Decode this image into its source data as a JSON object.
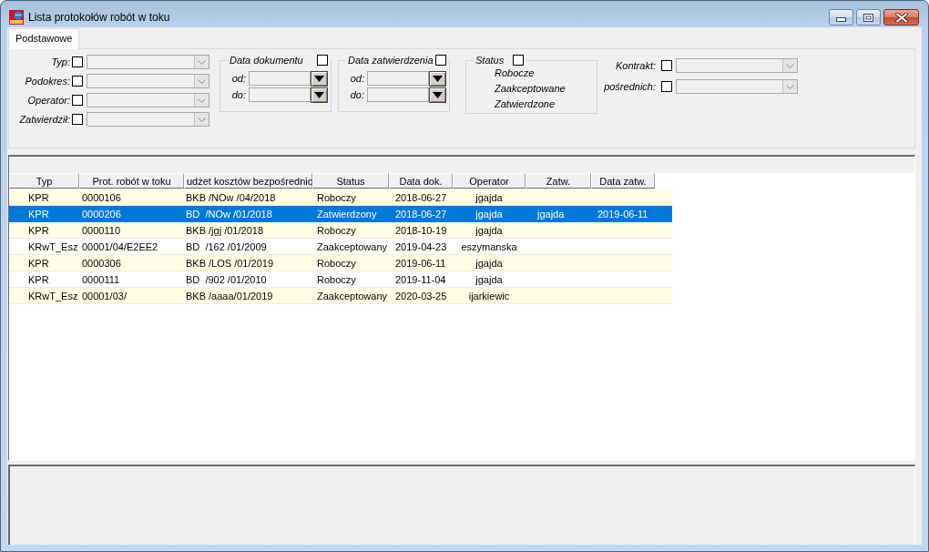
{
  "window": {
    "title": "Lista protokołów robót w toku"
  },
  "tabs": [
    {
      "label": "Podstawowe",
      "selected": true
    }
  ],
  "filters": {
    "left": [
      {
        "label": "Typ:",
        "checked": false,
        "disabled": true
      },
      {
        "label": "Podokres:",
        "checked": false,
        "disabled": true
      },
      {
        "label": "Operator:",
        "checked": false,
        "disabled": true
      },
      {
        "label": "Zatwierdził:",
        "checked": false,
        "disabled": true
      }
    ],
    "date_groups": [
      {
        "title": "Data dokumentu",
        "checked": false,
        "fields": [
          {
            "label": "od:",
            "disabled": true
          },
          {
            "label": "do:",
            "disabled": true
          }
        ]
      },
      {
        "title": "Data zatwierdzenia",
        "checked": false,
        "fields": [
          {
            "label": "od:",
            "disabled": true
          },
          {
            "label": "do:",
            "disabled": true
          }
        ]
      }
    ],
    "status_group": {
      "title": "Status",
      "checked": false,
      "items": [
        "Robocze",
        "Zaakceptowane",
        "Zatwierdzone"
      ]
    },
    "right": [
      {
        "label": "Kontrakt:",
        "checked": false,
        "disabled": true
      },
      {
        "label": "pośrednich:",
        "checked": false,
        "disabled": true
      }
    ]
  },
  "table": {
    "columns": [
      "Typ",
      "Prot. robót w toku",
      "udżet kosztów bezpośrednic",
      "Status",
      "Data dok.",
      "Operator",
      "Zatw.",
      "Data zatw."
    ],
    "rows": [
      {
        "typ": "KPR",
        "protokol": "0000106",
        "budzet_kosztow": "BKB /NOw /04/2018",
        "status": "Roboczy",
        "data_dok": "2018-06-27",
        "operator": "jgajda",
        "selected": false
      },
      {
        "typ": "KPR",
        "protokol": "0000206",
        "budzet_kosztow": "BD  /NOw /01/2018",
        "status": "Zatwierdzony",
        "data_dok": "2018-06-27",
        "operator": "jgajda",
        "zatw": "jgajda",
        "data_zatw": "2019-06-11",
        "selected": true
      },
      {
        "typ": "KPR",
        "protokol": "0000110",
        "budzet_kosztow": "BKB /jgj /01/2018",
        "status": "Roboczy",
        "data_dok": "2018-10-19",
        "operator": "jgajda",
        "selected": false
      },
      {
        "typ": "KRwT_Esz",
        "protokol": "00001/04/E2EE2",
        "budzet_kosztow": "BD  /162 /01/2009",
        "status": "Zaakceptowany",
        "data_dok": "2019-04-23",
        "operator": "eszymanska",
        "selected": false
      },
      {
        "typ": "KPR",
        "protokol": "0000306",
        "budzet_kosztow": "BKB /LOS /01/2019",
        "status": "Roboczy",
        "data_dok": "2019-06-11",
        "operator": "jgajda",
        "selected": false
      },
      {
        "typ": "KPR",
        "protokol": "0000111",
        "budzet_kosztow": "BD  /902 /01/2010",
        "status": "Roboczy",
        "data_dok": "2019-11-04",
        "operator": "jgajda",
        "selected": false
      },
      {
        "typ": "KRwT_Esz",
        "protokol": "00001/03/",
        "budzet_kosztow": "BKB /aaaa/01/2019",
        "status": "Zaakceptowany",
        "data_dok": "2020-03-25",
        "operator": "ijarkiewic",
        "selected": false
      }
    ]
  }
}
